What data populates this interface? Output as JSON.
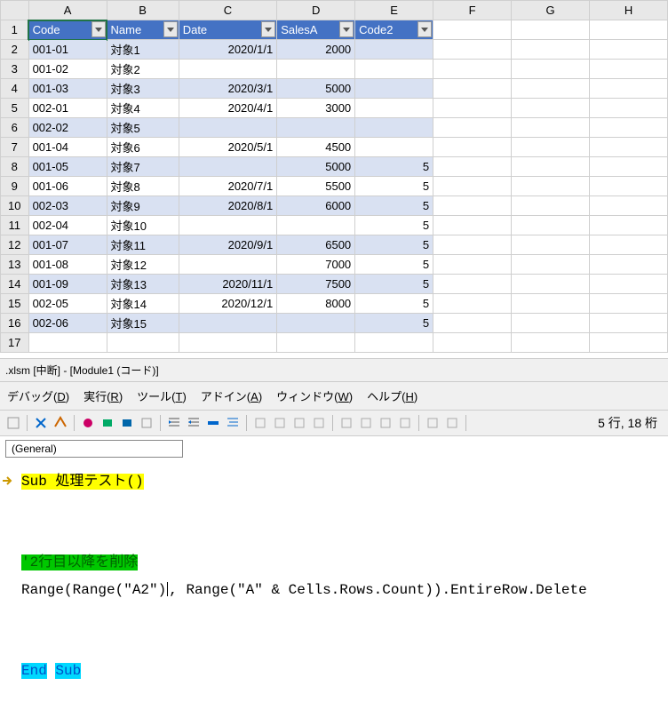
{
  "sheet": {
    "col_headers": [
      "A",
      "B",
      "C",
      "D",
      "E",
      "F",
      "G",
      "H"
    ],
    "row_numbers": [
      "1",
      "2",
      "3",
      "4",
      "5",
      "6",
      "7",
      "8",
      "9",
      "10",
      "11",
      "12",
      "13",
      "14",
      "15",
      "16",
      "17"
    ],
    "table_headers": [
      "Code",
      "Name",
      "Date",
      "SalesA",
      "Code2"
    ],
    "rows": [
      {
        "code": "001-01",
        "name": "対象1",
        "date": "2020/1/1",
        "sales": "2000",
        "code2": ""
      },
      {
        "code": "001-02",
        "name": "対象2",
        "date": "",
        "sales": "",
        "code2": ""
      },
      {
        "code": "001-03",
        "name": "対象3",
        "date": "2020/3/1",
        "sales": "5000",
        "code2": ""
      },
      {
        "code": "002-01",
        "name": "対象4",
        "date": "2020/4/1",
        "sales": "3000",
        "code2": ""
      },
      {
        "code": "002-02",
        "name": "対象5",
        "date": "",
        "sales": "",
        "code2": ""
      },
      {
        "code": "001-04",
        "name": "対象6",
        "date": "2020/5/1",
        "sales": "4500",
        "code2": ""
      },
      {
        "code": "001-05",
        "name": "対象7",
        "date": "",
        "sales": "5000",
        "code2": "5"
      },
      {
        "code": "001-06",
        "name": "対象8",
        "date": "2020/7/1",
        "sales": "5500",
        "code2": "5"
      },
      {
        "code": "002-03",
        "name": "対象9",
        "date": "2020/8/1",
        "sales": "6000",
        "code2": "5"
      },
      {
        "code": "002-04",
        "name": "対象10",
        "date": "",
        "sales": "",
        "code2": "5"
      },
      {
        "code": "001-07",
        "name": "対象11",
        "date": "2020/9/1",
        "sales": "6500",
        "code2": "5"
      },
      {
        "code": "001-08",
        "name": "対象12",
        "date": "",
        "sales": "7000",
        "code2": "5"
      },
      {
        "code": "001-09",
        "name": "対象13",
        "date": "2020/11/1",
        "sales": "7500",
        "code2": "5"
      },
      {
        "code": "002-05",
        "name": "対象14",
        "date": "2020/12/1",
        "sales": "8000",
        "code2": "5"
      },
      {
        "code": "002-06",
        "name": "対象15",
        "date": "",
        "sales": "",
        "code2": "5"
      }
    ]
  },
  "vbe": {
    "title_prefix": ".xlsm [中断] - [Module1 (コード)]",
    "menu": {
      "debug": "デバッグ(D)",
      "run": "実行(R)",
      "tool": "ツール(T)",
      "addin": "アドイン(A)",
      "window": "ウィンドウ(W)",
      "help": "ヘルプ(H)"
    },
    "dropdown": "(General)",
    "position": "5 行, 18 桁",
    "code": {
      "sub_open": "Sub 処理テスト()",
      "comment": "'2行目以降を削除",
      "stmt_a": "Range(Range(\"A2\")",
      "stmt_b": ", Range(\"A\" & Cells.Rows.Count)).EntireRow.Delete",
      "end": "End",
      "sub": "Sub"
    }
  }
}
